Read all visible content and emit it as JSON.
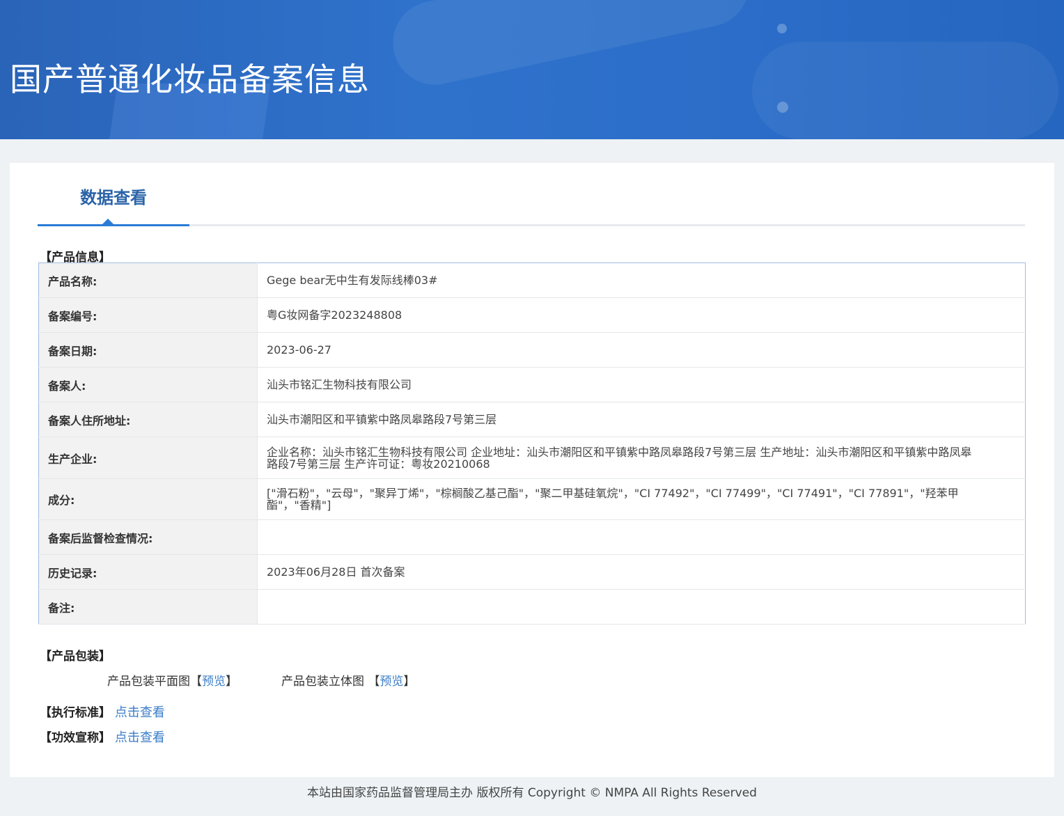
{
  "header": {
    "title": "国产普通化妆品备案信息"
  },
  "tab": {
    "label": "数据查看"
  },
  "sections": {
    "product_info": "【产品信息】",
    "packaging": "【产品包装】",
    "standard": "【执行标准】",
    "efficacy": "【功效宣称】"
  },
  "info_rows": [
    {
      "label": "产品名称:",
      "value": "Gege bear无中生有发际线棒03#"
    },
    {
      "label": "备案编号:",
      "value": "粤G妆网备字2023248808"
    },
    {
      "label": "备案日期:",
      "value": "2023-06-27"
    },
    {
      "label": "备案人:",
      "value": "汕头市铭汇生物科技有限公司"
    },
    {
      "label": "备案人住所地址:",
      "value": "汕头市潮阳区和平镇紫中路凤皋路段7号第三层"
    },
    {
      "label": "生产企业:",
      "value": "企业名称：汕头市铭汇生物科技有限公司 企业地址：汕头市潮阳区和平镇紫中路凤皋路段7号第三层 生产地址：汕头市潮阳区和平镇紫中路凤皋路段7号第三层 生产许可证：粤妆20210068"
    },
    {
      "label": "成分:",
      "value": "[\"滑石粉\"，\"云母\"，\"聚异丁烯\"，\"棕榈酸乙基己酯\"，\"聚二甲基硅氧烷\"，\"CI 77492\"，\"CI 77499\"，\"CI 77491\"，\"CI 77891\"，\"羟苯甲酯\"，\"香精\"]"
    },
    {
      "label": "备案后监督检查情况:",
      "value": ""
    },
    {
      "label": "历史记录:",
      "value": "2023年06月28日 首次备案"
    },
    {
      "label": "备注:",
      "value": ""
    }
  ],
  "packaging": {
    "flat_label": "产品包装平面图",
    "flat_link": "预览",
    "stereo_label": "产品包装立体图 ",
    "stereo_link": "预览",
    "bracket_open": "【",
    "bracket_close": "】"
  },
  "links": {
    "standard_link": "点击查看",
    "efficacy_link": "点击查看"
  },
  "footer": {
    "text": "本站由国家药品监督管理局主办 版权所有 Copyright © NMPA All Rights Reserved"
  }
}
